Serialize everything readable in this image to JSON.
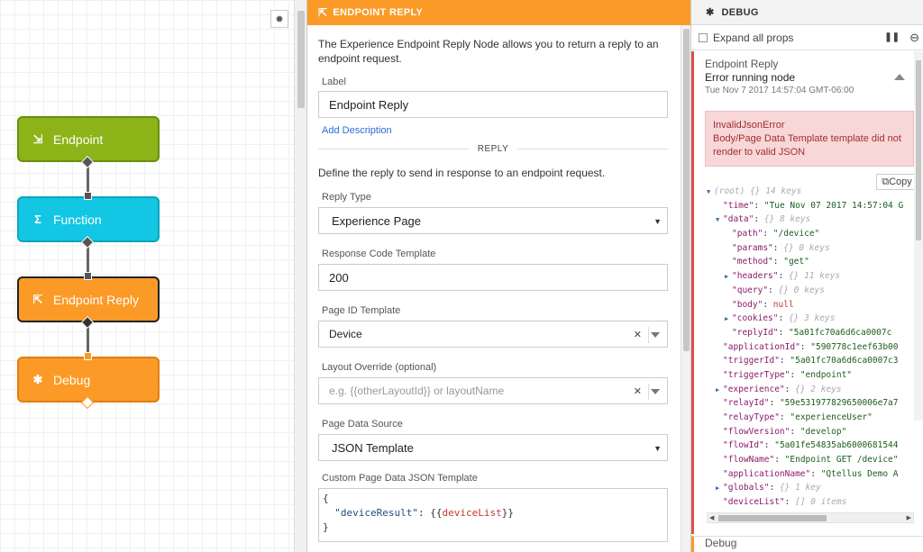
{
  "canvas": {
    "settings_icon": "gear-icon",
    "nodes": [
      {
        "label": "Endpoint",
        "icon": "endpoint-icon",
        "color": "#8cb318"
      },
      {
        "label": "Function",
        "icon": "sigma-icon",
        "color": "#13c6e3"
      },
      {
        "label": "Endpoint Reply",
        "icon": "endpoint-reply-icon",
        "color": "#fb9a26"
      },
      {
        "label": "Debug",
        "icon": "bug-icon",
        "color": "#fb9a26"
      }
    ]
  },
  "panel": {
    "title": "ENDPOINT REPLY",
    "description": "The Experience Endpoint Reply Node allows you to return a reply to an endpoint request.",
    "label_label": "Label",
    "label_value": "Endpoint Reply",
    "add_description": "Add Description",
    "section_reply": "REPLY",
    "reply_description": "Define the reply to send in response to an endpoint request.",
    "reply_type_label": "Reply Type",
    "reply_type_value": "Experience Page",
    "response_code_label": "Response Code Template",
    "response_code_value": "200",
    "page_id_label": "Page ID Template",
    "page_id_value": "Device",
    "layout_override_label": "Layout Override (optional)",
    "layout_override_placeholder": "e.g. {{otherLayoutId}} or layoutName",
    "page_data_source_label": "Page Data Source",
    "page_data_source_value": "JSON Template",
    "custom_json_label": "Custom Page Data JSON Template",
    "json_line1": "{",
    "json_key": "\"deviceResult\"",
    "json_colon": ": {{",
    "json_var": "deviceList",
    "json_end": "}}",
    "json_line3": "}"
  },
  "debug": {
    "title": "DEBUG",
    "expand_all": "Expand all props",
    "entry_title": "Endpoint Reply",
    "entry_subtitle": "Error running node",
    "entry_time": "Tue Nov 7 2017 14:57:04 GMT-06:00",
    "error_name": "InvalidJsonError",
    "error_message": "Body/Page Data Template template did not render to valid JSON",
    "copy_label": "Copy",
    "second_entry": "Debug",
    "accent_error": "#d9534f"
  },
  "tree": [
    {
      "indent": 0,
      "arrow": "▼",
      "key": "(root)",
      "meta": "{}  14 keys",
      "root": true
    },
    {
      "indent": 1,
      "key": "\"time\"",
      "value": "\"Tue Nov 07 2017 14:57:04 G"
    },
    {
      "indent": 1,
      "arrow": "▼",
      "key": "\"data\"",
      "meta": "{}  8 keys"
    },
    {
      "indent": 2,
      "key": "\"path\"",
      "value": "\"/device\""
    },
    {
      "indent": 2,
      "key": "\"params\"",
      "meta": "{}  0 keys"
    },
    {
      "indent": 2,
      "key": "\"method\"",
      "value": "\"get\""
    },
    {
      "indent": 2,
      "arrow": "▶",
      "key": "\"headers\"",
      "meta": "{}  11 keys"
    },
    {
      "indent": 2,
      "key": "\"query\"",
      "meta": "{}  0 keys"
    },
    {
      "indent": 2,
      "key": "\"body\"",
      "null": "null"
    },
    {
      "indent": 2,
      "arrow": "▶",
      "key": "\"cookies\"",
      "meta": "{}  3 keys"
    },
    {
      "indent": 2,
      "key": "\"replyId\"",
      "value": "\"5a01fc70a6d6ca0007c"
    },
    {
      "indent": 1,
      "key": "\"applicationId\"",
      "value": "\"590778c1eef63b00"
    },
    {
      "indent": 1,
      "key": "\"triggerId\"",
      "value": "\"5a01fc70a6d6ca0007c3"
    },
    {
      "indent": 1,
      "key": "\"triggerType\"",
      "value": "\"endpoint\""
    },
    {
      "indent": 1,
      "arrow": "▶",
      "key": "\"experience\"",
      "meta": "{}  2 keys"
    },
    {
      "indent": 1,
      "key": "\"relayId\"",
      "value": "\"59e531977829650006e7a7"
    },
    {
      "indent": 1,
      "key": "\"relayType\"",
      "value": "\"experienceUser\""
    },
    {
      "indent": 1,
      "key": "\"flowVersion\"",
      "value": "\"develop\""
    },
    {
      "indent": 1,
      "key": "\"flowId\"",
      "value": "\"5a01fe54835ab6000681544"
    },
    {
      "indent": 1,
      "key": "\"flowName\"",
      "value": "\"Endpoint GET /device\""
    },
    {
      "indent": 1,
      "key": "\"applicationName\"",
      "value": "\"Qtellus Demo A"
    },
    {
      "indent": 1,
      "arrow": "▶",
      "key": "\"globals\"",
      "meta": "{}  1 key"
    },
    {
      "indent": 1,
      "key": "\"deviceList\"",
      "meta": "[]  0 items"
    }
  ]
}
